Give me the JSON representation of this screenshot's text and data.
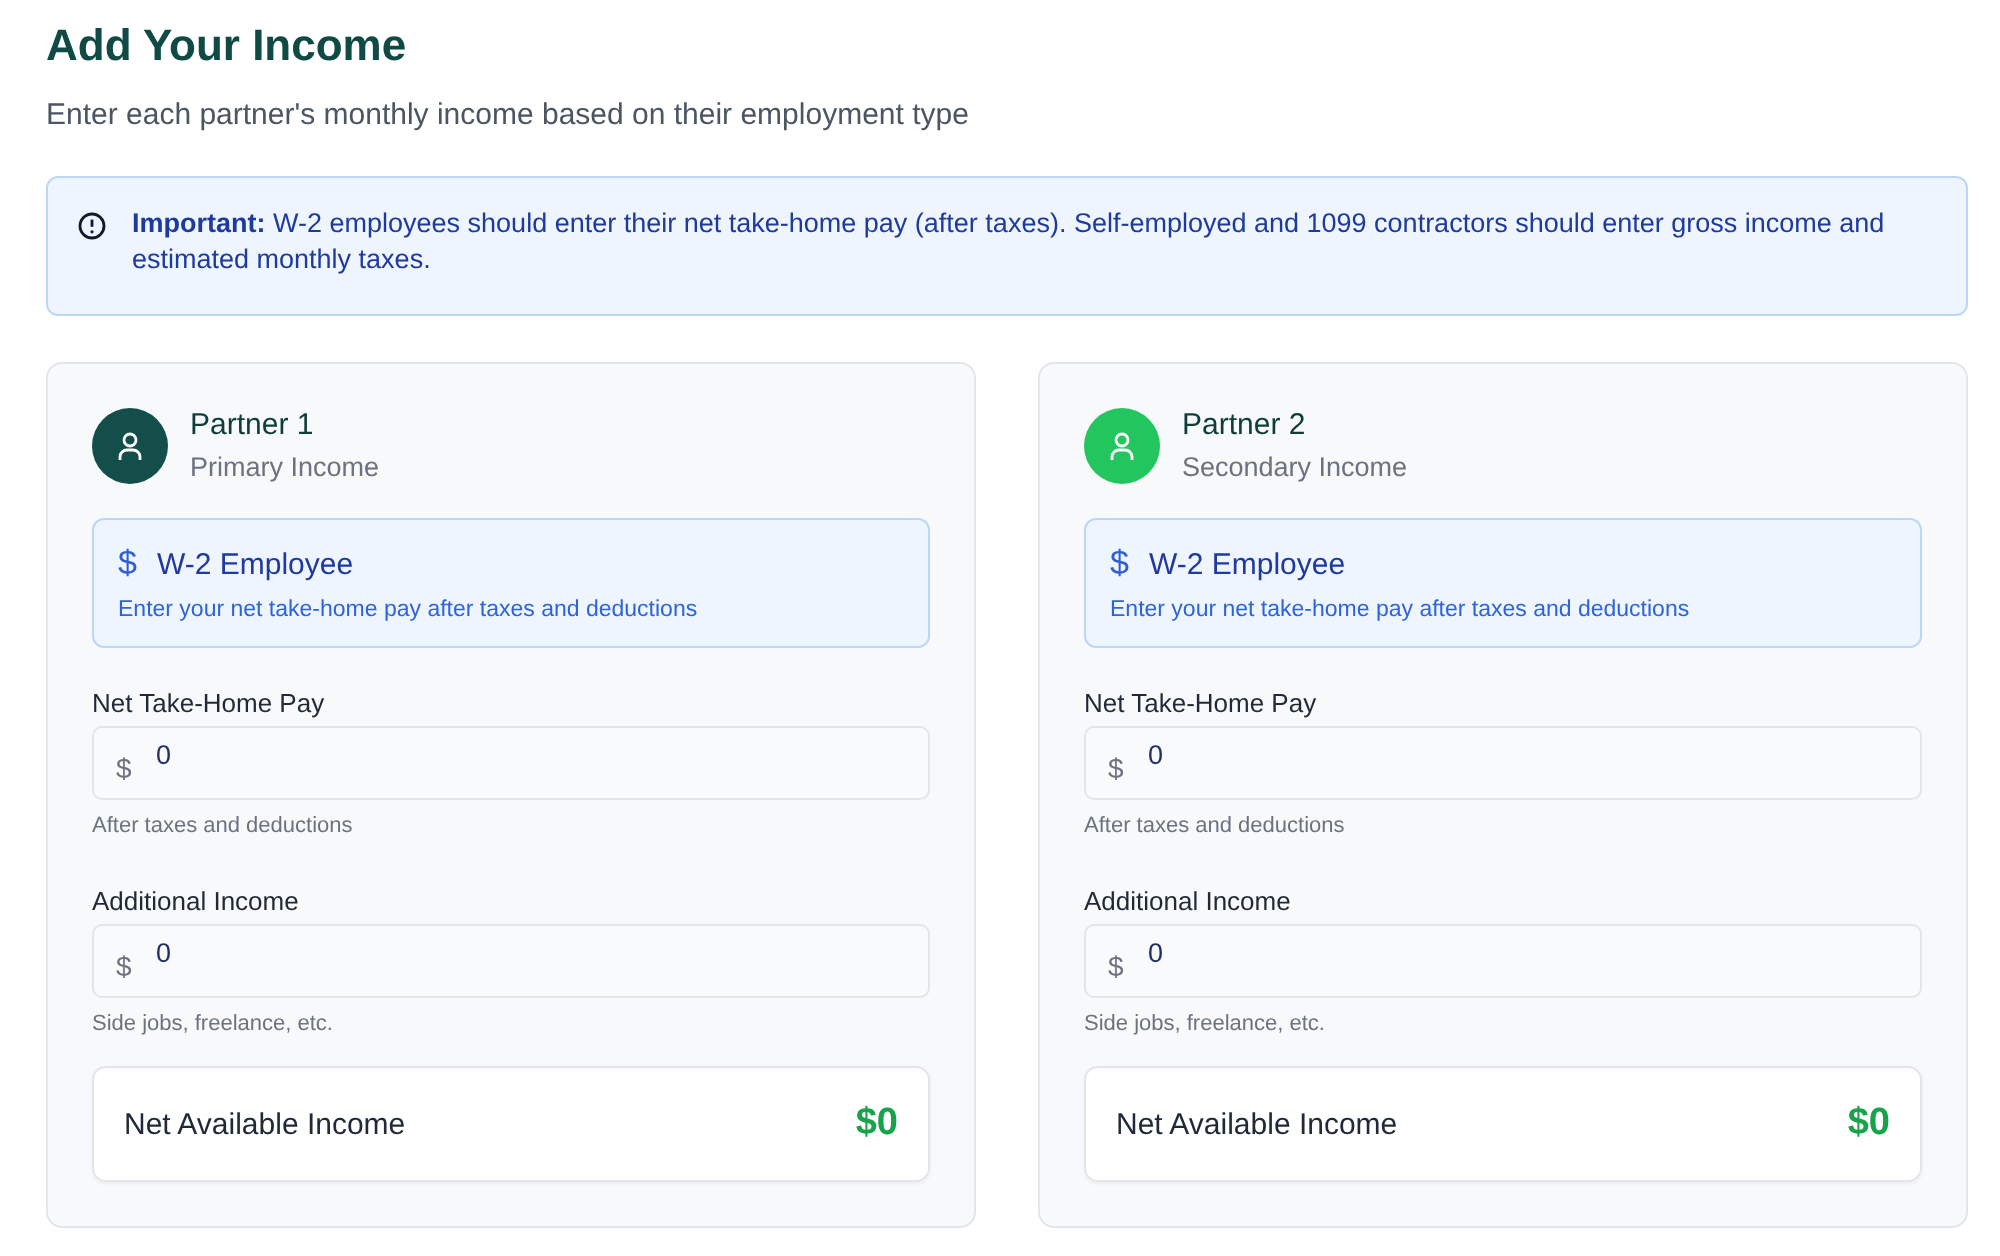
{
  "title": "Add Your Income",
  "subtitle": "Enter each partner's monthly income based on their employment type",
  "notice": "**Important:** W-2 employees should enter their net take-home pay (after taxes). Self-employed and 1099 contractors should enter gross income and estimated monthly taxes.",
  "partners": [
    {
      "name": "Partner 1",
      "role": "Primary Income",
      "color": "#134e4a",
      "employment": {
        "symbol": "$",
        "title": "W-2 Employee",
        "description": "Enter your net take-home pay after taxes and deductions"
      },
      "fields": [
        {
          "label": "Net Take-Home Pay",
          "prefix": "$",
          "value": "0",
          "hint": "After taxes and deductions"
        },
        {
          "label": "Additional Income",
          "prefix": "$",
          "value": "0",
          "hint": "Side jobs, freelance, etc."
        }
      ],
      "summary": {
        "label": "Net Available Income",
        "value": "$0"
      }
    },
    {
      "name": "Partner 2",
      "role": "Secondary Income",
      "color": "#22c55e",
      "employment": {
        "symbol": "$",
        "title": "W-2 Employee",
        "description": "Enter your net take-home pay after taxes and deductions"
      },
      "fields": [
        {
          "label": "Net Take-Home Pay",
          "prefix": "$",
          "value": "0",
          "hint": "After taxes and deductions"
        },
        {
          "label": "Additional Income",
          "prefix": "$",
          "value": "0",
          "hint": "Side jobs, freelance, etc."
        }
      ],
      "summary": {
        "label": "Net Available Income",
        "value": "$0"
      }
    }
  ]
}
